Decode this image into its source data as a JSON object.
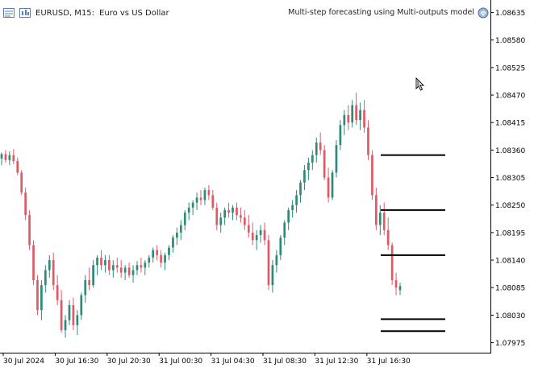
{
  "header": {
    "symbol": "EURUSD, M15:",
    "description": "Euro vs US Dollar",
    "expert_name": "Multi-step forecasting using Multi-outputs model"
  },
  "colors": {
    "bull": "#2e8b7a",
    "bear": "#e05a66",
    "axis": "#000000",
    "level": "#000000"
  },
  "chart_data": {
    "type": "candlestick",
    "y_axis_ticks": [
      "1.08635",
      "1.08580",
      "1.08525",
      "1.08470",
      "1.08415",
      "1.08360",
      "1.08305",
      "1.08250",
      "1.08195",
      "1.08140",
      "1.08085",
      "1.08030",
      "1.07975"
    ],
    "x_axis_ticks": [
      "30 Jul 2024",
      "30 Jul 16:30",
      "30 Jul 20:30",
      "31 Jul 00:30",
      "31 Jul 04:30",
      "31 Jul 08:30",
      "31 Jul 12:30",
      "31 Jul 16:30"
    ],
    "ylim": [
      1.07955,
      1.0866
    ],
    "forecast_levels": [
      1.0835,
      1.0824,
      1.0815,
      1.08022,
      1.07998
    ],
    "candles": [
      [
        1.08343,
        1.08355,
        1.0833,
        1.08352
      ],
      [
        1.08352,
        1.0836,
        1.08335,
        1.0834
      ],
      [
        1.0834,
        1.08358,
        1.0833,
        1.0835
      ],
      [
        1.0835,
        1.08362,
        1.08332,
        1.08338
      ],
      [
        1.08338,
        1.08345,
        1.0831,
        1.08315
      ],
      [
        1.08315,
        1.0832,
        1.0827,
        1.08275
      ],
      [
        1.08275,
        1.08285,
        1.0822,
        1.0823
      ],
      [
        1.0823,
        1.0824,
        1.0816,
        1.0817
      ],
      [
        1.0817,
        1.0818,
        1.0809,
        1.081
      ],
      [
        1.081,
        1.0811,
        1.0803,
        1.0804
      ],
      [
        1.0804,
        1.081,
        1.0802,
        1.0809
      ],
      [
        1.0809,
        1.0813,
        1.08075,
        1.0812
      ],
      [
        1.0812,
        1.0815,
        1.08105,
        1.0814
      ],
      [
        1.0814,
        1.08155,
        1.0808,
        1.0809
      ],
      [
        1.0809,
        1.0811,
        1.0805,
        1.0806
      ],
      [
        1.0806,
        1.0808,
        1.07995,
        1.08
      ],
      [
        1.08,
        1.0803,
        1.07985,
        1.0802
      ],
      [
        1.0802,
        1.0806,
        1.0801,
        1.0805
      ],
      [
        1.0805,
        1.08065,
        1.08,
        1.0801
      ],
      [
        1.0801,
        1.0804,
        1.0799,
        1.0803
      ],
      [
        1.0803,
        1.08075,
        1.0802,
        1.0807
      ],
      [
        1.0807,
        1.0811,
        1.08055,
        1.081
      ],
      [
        1.081,
        1.08125,
        1.0808,
        1.0809
      ],
      [
        1.0809,
        1.0814,
        1.08085,
        1.0813
      ],
      [
        1.0813,
        1.0815,
        1.0811,
        1.08145
      ],
      [
        1.08145,
        1.0816,
        1.0812,
        1.0813
      ],
      [
        1.0813,
        1.0815,
        1.08115,
        1.0814
      ],
      [
        1.0814,
        1.0815,
        1.0811,
        1.0812
      ],
      [
        1.0812,
        1.0814,
        1.08105,
        1.0813
      ],
      [
        1.0813,
        1.08145,
        1.08115,
        1.08125
      ],
      [
        1.08125,
        1.0814,
        1.08105,
        1.08115
      ],
      [
        1.08115,
        1.0813,
        1.081,
        1.08125
      ],
      [
        1.08125,
        1.08135,
        1.08105,
        1.0811
      ],
      [
        1.0811,
        1.0813,
        1.08095,
        1.0812
      ],
      [
        1.0812,
        1.08138,
        1.0811,
        1.0813
      ],
      [
        1.0813,
        1.08145,
        1.08115,
        1.08125
      ],
      [
        1.08125,
        1.0814,
        1.0811,
        1.08135
      ],
      [
        1.08135,
        1.0815,
        1.08125,
        1.08145
      ],
      [
        1.08145,
        1.08165,
        1.08135,
        1.0816
      ],
      [
        1.0816,
        1.0817,
        1.0814,
        1.0815
      ],
      [
        1.0815,
        1.0816,
        1.08125,
        1.08135
      ],
      [
        1.08135,
        1.08155,
        1.0812,
        1.0815
      ],
      [
        1.0815,
        1.0817,
        1.0814,
        1.08165
      ],
      [
        1.08165,
        1.0819,
        1.08155,
        1.08185
      ],
      [
        1.08185,
        1.08205,
        1.0817,
        1.08195
      ],
      [
        1.08195,
        1.0822,
        1.0818,
        1.0821
      ],
      [
        1.0821,
        1.0824,
        1.082,
        1.08235
      ],
      [
        1.08235,
        1.08255,
        1.0822,
        1.08245
      ],
      [
        1.08245,
        1.0826,
        1.0823,
        1.08255
      ],
      [
        1.08255,
        1.08275,
        1.0824,
        1.08265
      ],
      [
        1.08265,
        1.0828,
        1.0825,
        1.0826
      ],
      [
        1.0826,
        1.08285,
        1.0825,
        1.0828
      ],
      [
        1.0828,
        1.0829,
        1.0826,
        1.0827
      ],
      [
        1.0827,
        1.0828,
        1.0824,
        1.08245
      ],
      [
        1.08245,
        1.08255,
        1.082,
        1.0821
      ],
      [
        1.0821,
        1.08235,
        1.08195,
        1.08225
      ],
      [
        1.08225,
        1.08245,
        1.0821,
        1.0824
      ],
      [
        1.0824,
        1.08255,
        1.08225,
        1.08235
      ],
      [
        1.08235,
        1.0825,
        1.0822,
        1.08245
      ],
      [
        1.08245,
        1.08255,
        1.0822,
        1.0823
      ],
      [
        1.0823,
        1.08245,
        1.08215,
        1.08225
      ],
      [
        1.08225,
        1.0824,
        1.082,
        1.0821
      ],
      [
        1.0821,
        1.0823,
        1.08185,
        1.08195
      ],
      [
        1.08195,
        1.08215,
        1.0817,
        1.0818
      ],
      [
        1.0818,
        1.082,
        1.0816,
        1.0819
      ],
      [
        1.0819,
        1.0821,
        1.08175,
        1.082
      ],
      [
        1.082,
        1.08215,
        1.0817,
        1.0818
      ],
      [
        1.0818,
        1.0819,
        1.0808,
        1.0809
      ],
      [
        1.0809,
        1.0814,
        1.08075,
        1.0813
      ],
      [
        1.0813,
        1.0816,
        1.08115,
        1.0815
      ],
      [
        1.0815,
        1.0819,
        1.0814,
        1.08185
      ],
      [
        1.08185,
        1.0822,
        1.0817,
        1.08215
      ],
      [
        1.08215,
        1.08245,
        1.082,
        1.0824
      ],
      [
        1.0824,
        1.0826,
        1.08225,
        1.0825
      ],
      [
        1.0825,
        1.0828,
        1.08235,
        1.0827
      ],
      [
        1.0827,
        1.083,
        1.08255,
        1.08295
      ],
      [
        1.08295,
        1.0833,
        1.0828,
        1.0832
      ],
      [
        1.0832,
        1.08345,
        1.083,
        1.08335
      ],
      [
        1.08335,
        1.0836,
        1.0832,
        1.0835
      ],
      [
        1.0835,
        1.08385,
        1.08335,
        1.08375
      ],
      [
        1.08375,
        1.08395,
        1.0835,
        1.0836
      ],
      [
        1.0836,
        1.0837,
        1.083,
        1.08305
      ],
      [
        1.08305,
        1.08325,
        1.08255,
        1.08265
      ],
      [
        1.08265,
        1.0832,
        1.0826,
        1.08315
      ],
      [
        1.08315,
        1.0838,
        1.08305,
        1.0837
      ],
      [
        1.0837,
        1.0842,
        1.0836,
        1.0841
      ],
      [
        1.0841,
        1.0844,
        1.0839,
        1.0843
      ],
      [
        1.0843,
        1.0845,
        1.084,
        1.08415
      ],
      [
        1.08415,
        1.0846,
        1.08405,
        1.0845
      ],
      [
        1.0845,
        1.08475,
        1.0841,
        1.0842
      ],
      [
        1.0842,
        1.08455,
        1.084,
        1.0844
      ],
      [
        1.0844,
        1.0846,
        1.08395,
        1.08405
      ],
      [
        1.08405,
        1.0842,
        1.0834,
        1.0835
      ],
      [
        1.0835,
        1.0836,
        1.0826,
        1.0827
      ],
      [
        1.0827,
        1.08285,
        1.082,
        1.0821
      ],
      [
        1.0821,
        1.0825,
        1.0819,
        1.08235
      ],
      [
        1.08235,
        1.08255,
        1.0819,
        1.082
      ],
      [
        1.082,
        1.08225,
        1.0816,
        1.0817
      ],
      [
        1.0817,
        1.08175,
        1.0809,
        1.081
      ],
      [
        1.081,
        1.08115,
        1.0807,
        1.08085
      ],
      [
        1.0808,
        1.08095,
        1.0807,
        1.08088
      ]
    ]
  }
}
